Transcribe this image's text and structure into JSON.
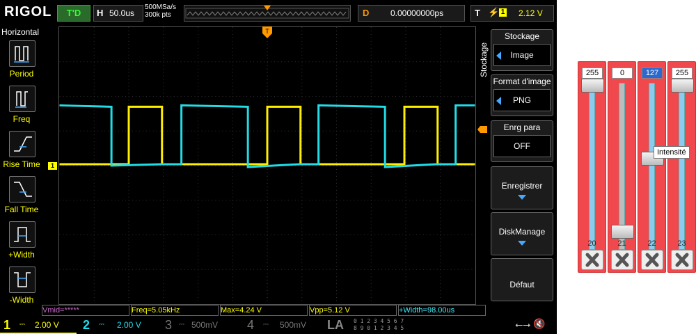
{
  "header": {
    "logo": "RIGOL",
    "mode": "T'D",
    "h_label": "H",
    "h_value": "50.0us",
    "sample_rate": "500MSa/s",
    "points": "300k pts",
    "d_label": "D",
    "d_value": "0.00000000ps",
    "t_label": "T",
    "trigger_channel": "1",
    "trigger_level": "2.12 V",
    "trigger_marker": "T"
  },
  "left_menu": {
    "title": "Horizontal",
    "items": [
      {
        "label": "Period",
        "icon": "period-icon"
      },
      {
        "label": "Freq",
        "icon": "frequency-icon"
      },
      {
        "label": "Rise Time",
        "icon": "rise-time-icon"
      },
      {
        "label": "Fall Time",
        "icon": "fall-time-icon"
      },
      {
        "label": "+Width",
        "icon": "positive-width-icon"
      },
      {
        "label": "-Width",
        "icon": "negative-width-icon"
      }
    ]
  },
  "right_menu": {
    "side_label": "Stockage",
    "title": "Stockage",
    "image_value": "Image",
    "format_title": "Format d'image",
    "format_value": "PNG",
    "save_param_title": "Enrg para",
    "save_param_value": "OFF",
    "save_button": "Enregistrer",
    "disk_button": "DiskManage",
    "default_button": "Défaut"
  },
  "measurements": {
    "vmid": "Vmid=*****",
    "freq": "Freq=5.05kHz",
    "max": "Max=4.24 V",
    "vpp": "Vpp=5.12 V",
    "width": "+Width=98.00us"
  },
  "channels": {
    "ch1_num": "1",
    "ch1_scale": "2.00 V",
    "ch2_num": "2",
    "ch2_scale": "2.00 V",
    "ch3_num": "3",
    "ch3_scale": "500mV",
    "ch4_num": "4",
    "ch4_scale": "500mV",
    "la": "LA",
    "la_bits_top": "0 1 2 3  4 5 6 7",
    "la_bits_bottom": "8 9 0 1  2 3 4 5"
  },
  "waveform": {
    "ch1_marker": "1",
    "ch1_color": "#ffee00",
    "ch2_color": "#22dde8"
  },
  "rgba_panel": {
    "sliders": [
      {
        "value": "255",
        "label": "20",
        "level": 1.0
      },
      {
        "value": "0",
        "label": "21",
        "level": 0.0
      },
      {
        "value": "127",
        "label": "22",
        "level": 0.5
      },
      {
        "value": "255",
        "label": "23",
        "level": 1.0
      }
    ],
    "tooltip": "Intensité",
    "bg_color": "#f0484c"
  }
}
